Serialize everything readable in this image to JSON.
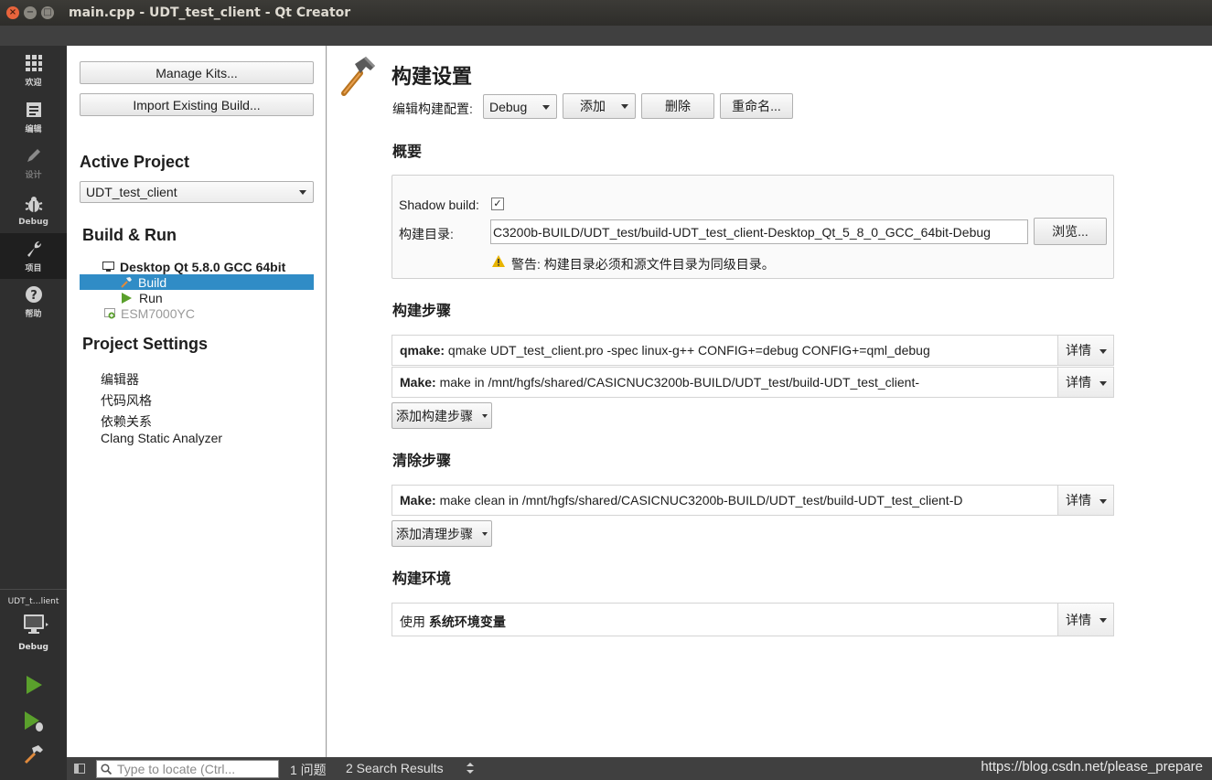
{
  "window": {
    "title": "main.cpp - UDT_test_client - Qt Creator",
    "close_glyph": "×",
    "min_glyph": "−",
    "max_glyph": "□"
  },
  "modes": [
    {
      "label": "欢迎",
      "icon": "grid-icon"
    },
    {
      "label": "编辑",
      "icon": "document-icon"
    },
    {
      "label": "设计",
      "icon": "pencil-icon"
    },
    {
      "label": "Debug",
      "icon": "bug-icon"
    },
    {
      "label": "项目",
      "icon": "wrench-icon"
    },
    {
      "label": "帮助",
      "icon": "help-icon"
    }
  ],
  "target_selector": {
    "project": "UDT_t…lient",
    "config": "Debug"
  },
  "nav": {
    "manage_kits": "Manage Kits...",
    "import_build": "Import Existing Build...",
    "active_project_heading": "Active Project",
    "active_project": "UDT_test_client",
    "build_run_heading": "Build & Run",
    "kit_name": "Desktop Qt 5.8.0 GCC 64bit",
    "build_item": "Build",
    "run_item": "Run",
    "other_kit": "ESM7000YC",
    "project_settings_heading": "Project Settings",
    "settings_items": [
      "编辑器",
      "代码风格",
      "依赖关系",
      "Clang Static Analyzer"
    ]
  },
  "main": {
    "heading": "构建设置",
    "edit_config_label": "编辑构建配置:",
    "config_value": "Debug",
    "add_button": "添加",
    "delete_button": "删除",
    "rename_button": "重命名...",
    "general": {
      "title": "概要",
      "shadow_build_label": "Shadow build:",
      "shadow_build_checked": "✓",
      "build_dir_label": "构建目录:",
      "build_dir_value": "C3200b-BUILD/UDT_test/build-UDT_test_client-Desktop_Qt_5_8_0_GCC_64bit-Debug",
      "browse_button": "浏览...",
      "warning": "警告: 构建目录必须和源文件目录为同级目录。"
    },
    "build_steps": {
      "title": "构建步骤",
      "steps": [
        {
          "name": "qmake:",
          "text": " qmake UDT_test_client.pro -spec linux-g++ CONFIG+=debug CONFIG+=qml_debug"
        },
        {
          "name": "Make:",
          "text": " make in /mnt/hgfs/shared/CASICNUC3200b-BUILD/UDT_test/build-UDT_test_client-"
        }
      ],
      "add_step": "添加构建步骤"
    },
    "clean_steps": {
      "title": "清除步骤",
      "steps": [
        {
          "name": "Make:",
          "text": " make clean in /mnt/hgfs/shared/CASICNUC3200b-BUILD/UDT_test/build-UDT_test_client-D"
        }
      ],
      "add_step": "添加清理步骤"
    },
    "environment": {
      "title": "构建环境",
      "prefix": "使用 ",
      "value": "系统环境变量"
    },
    "details_label": "详情"
  },
  "statusbar": {
    "locator_placeholder": "Type to locate (Ctrl...",
    "issues": "1 问题",
    "search_results": "2 Search Results",
    "watermark": "https://blog.csdn.net/please_prepare"
  },
  "colors": {
    "selection": "#308cc6",
    "titlebar": "#3c3b37",
    "close_button": "#e8643c",
    "run_green": "#5aa02c",
    "warning_yellow": "#e8b400"
  }
}
